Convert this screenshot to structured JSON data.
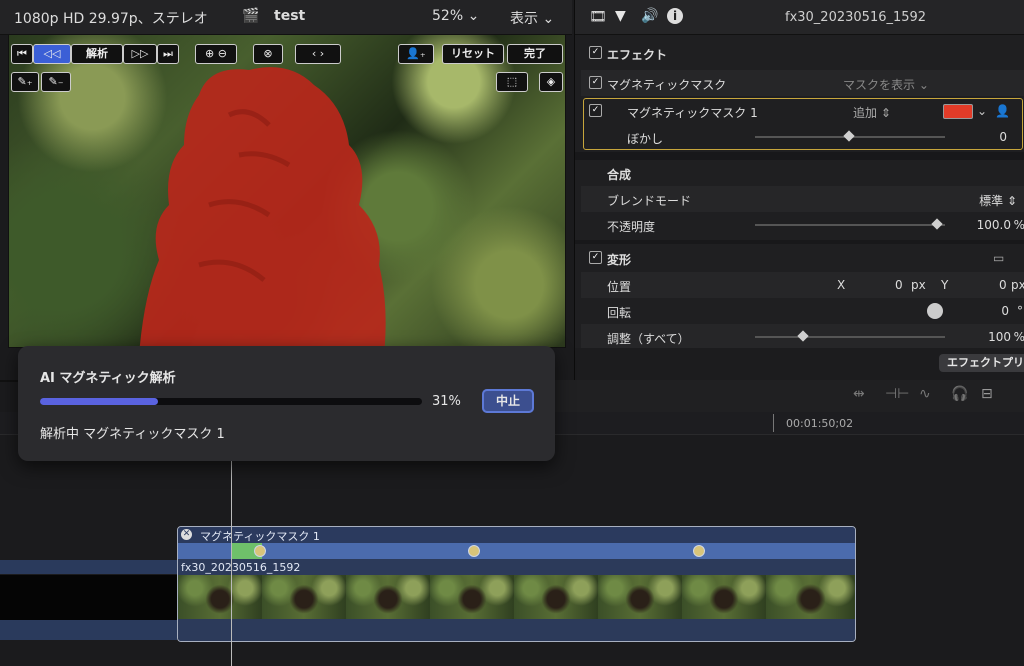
{
  "viewer": {
    "format": "1080p HD 29.97p、ステレオ",
    "project": "test",
    "zoom": "52%",
    "view_menu": "表示",
    "analyze_label": "解析",
    "reset_label": "リセット",
    "done_label": "完了"
  },
  "inspector": {
    "clip_name": "fx30_20230516_1592",
    "effects_header": "エフェクト",
    "magnetic_mask": "マグネティックマスク",
    "show_mask": "マスクを表示",
    "mask1": "マグネティックマスク 1",
    "add_label": "追加",
    "feather_label": "ぼかし",
    "feather_value": "0",
    "composite_header": "合成",
    "blend_mode_label": "ブレンドモード",
    "blend_mode_value": "標準",
    "opacity_label": "不透明度",
    "opacity_value": "100.0",
    "opacity_unit": "%",
    "transform_header": "変形",
    "position_label": "位置",
    "x_label": "X",
    "x_value": "0",
    "x_unit": "px",
    "y_label": "Y",
    "y_value": "0",
    "y_unit": "px",
    "rotation_label": "回転",
    "rotation_value": "0",
    "rotation_unit": "°",
    "scale_label": "調整（すべて）",
    "scale_value": "100",
    "scale_unit": "%",
    "effects_preset_button": "エフェクトプリ",
    "mask_color": "#e23b28"
  },
  "dialog": {
    "title": "AI マグネティック解析",
    "progress": 0.31,
    "progress_label": "31%",
    "cancel_label": "中止",
    "status": "解析中 マグネティックマスク 1"
  },
  "timeline": {
    "timecode": "00:01:50;02",
    "effect_bar_label": "マグネティックマスク 1",
    "clip_label": "fx30_20230516_1592"
  }
}
